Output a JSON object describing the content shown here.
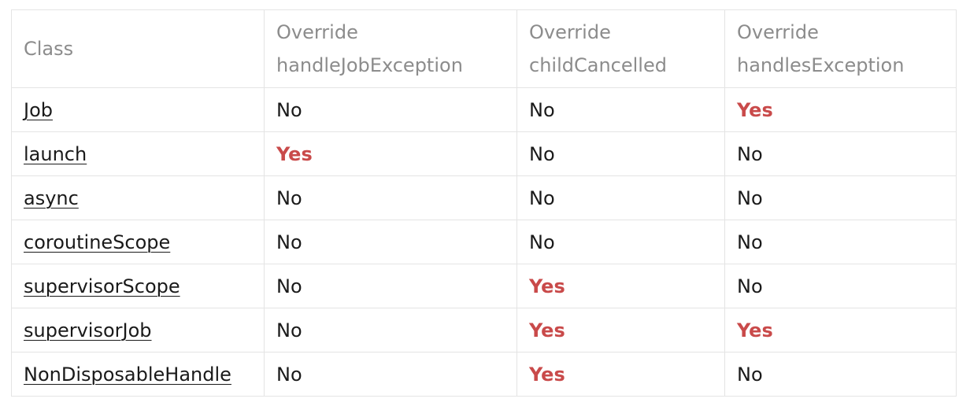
{
  "table": {
    "headers": [
      {
        "lines": [
          "Class"
        ]
      },
      {
        "lines": [
          "Override",
          "handleJobException"
        ]
      },
      {
        "lines": [
          "Override",
          "childCancelled"
        ]
      },
      {
        "lines": [
          "Override",
          "handlesException"
        ]
      }
    ],
    "rows": [
      {
        "class": "Job",
        "handleJobException": "No",
        "childCancelled": "No",
        "handlesException": "Yes"
      },
      {
        "class": "launch",
        "handleJobException": "Yes",
        "childCancelled": "No",
        "handlesException": "No"
      },
      {
        "class": "async",
        "handleJobException": "No",
        "childCancelled": "No",
        "handlesException": "No"
      },
      {
        "class": "coroutineScope",
        "handleJobException": "No",
        "childCancelled": "No",
        "handlesException": "No"
      },
      {
        "class": "supervisorScope",
        "handleJobException": "No",
        "childCancelled": "Yes",
        "handlesException": "No"
      },
      {
        "class": "supervisorJob",
        "handleJobException": "No",
        "childCancelled": "Yes",
        "handlesException": "Yes"
      },
      {
        "class": "NonDisposableHandle",
        "handleJobException": "No",
        "childCancelled": "Yes",
        "handlesException": "No"
      }
    ]
  },
  "colors": {
    "yes": "#c94a4a",
    "no": "#1a1a1a",
    "header": "#8c8c8c",
    "border": "#e4e4e4"
  }
}
